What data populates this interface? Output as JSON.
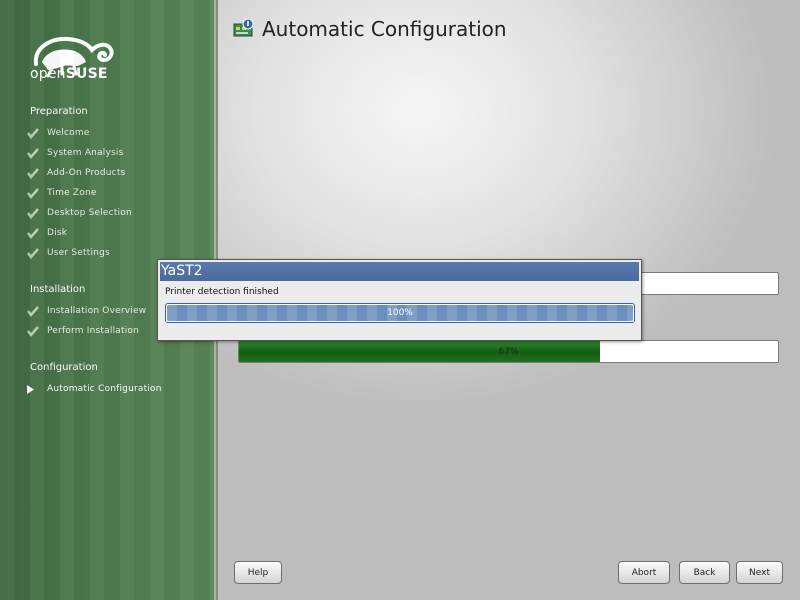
{
  "brand": {
    "open": "open",
    "suse": "SUSE"
  },
  "sidebar": {
    "sections": [
      {
        "title": "Preparation",
        "steps": [
          {
            "label": "Welcome",
            "state": "done"
          },
          {
            "label": "System Analysis",
            "state": "done"
          },
          {
            "label": "Add-On Products",
            "state": "done"
          },
          {
            "label": "Time Zone",
            "state": "done"
          },
          {
            "label": "Desktop Selection",
            "state": "done"
          },
          {
            "label": "Disk",
            "state": "done"
          },
          {
            "label": "User Settings",
            "state": "done"
          }
        ]
      },
      {
        "title": "Installation",
        "steps": [
          {
            "label": "Installation Overview",
            "state": "done"
          },
          {
            "label": "Perform Installation",
            "state": "done"
          }
        ]
      },
      {
        "title": "Configuration",
        "steps": [
          {
            "label": "Automatic Configuration",
            "state": "current"
          }
        ]
      }
    ]
  },
  "main": {
    "title": "Automatic Configuration",
    "title_icon": "network-config-icon",
    "overall_progress": {
      "percent": 67,
      "label": "67%"
    },
    "step_progress": {
      "percent": 0,
      "label": ""
    }
  },
  "dialog": {
    "title": "YaST2",
    "message": "Printer detection finished",
    "progress": {
      "percent": 100,
      "label": "100%"
    }
  },
  "buttons": {
    "help": "Help",
    "abort": "Abort",
    "back": "Back",
    "next": "Next"
  },
  "colors": {
    "sidebar_green": "#4c784c",
    "progress_green": "#1f731f",
    "dialog_title_blue": "#4a699d",
    "dialog_progress_blue": "#7f9fc7"
  }
}
